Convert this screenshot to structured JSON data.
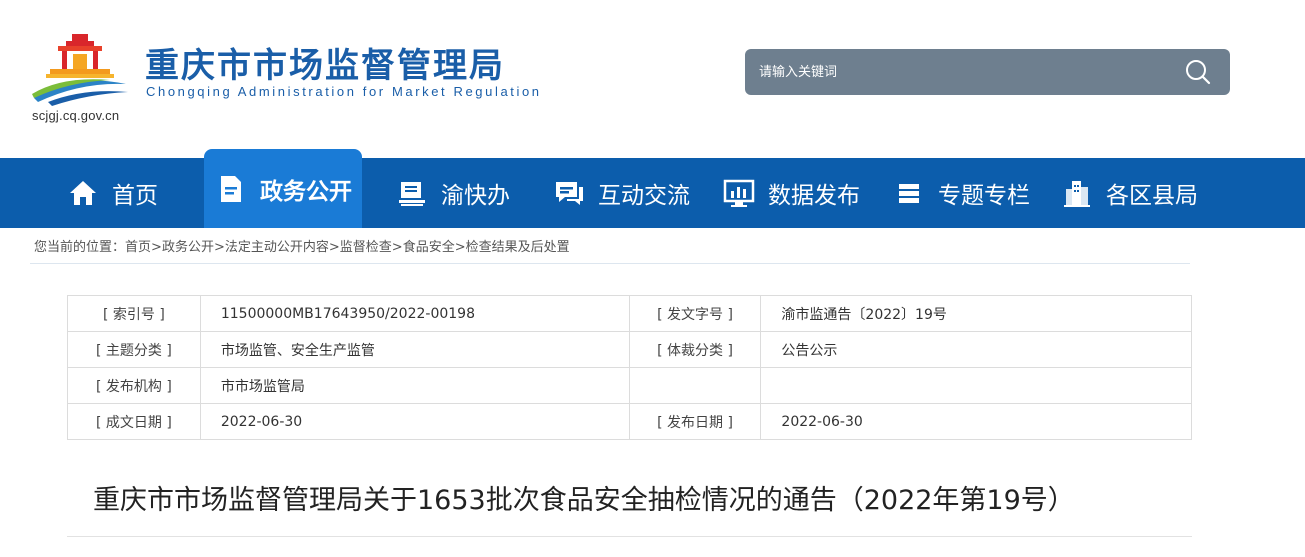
{
  "header": {
    "site_name": "重庆市市场监督管理局",
    "site_name_en": "Chongqing  Administration for Market Regulation",
    "site_url": "scjgj.cq.gov.cn",
    "logo_icon": "cq-amr-logo-icon"
  },
  "search": {
    "placeholder": "请输入关键词",
    "icon": "search-icon"
  },
  "nav": {
    "items": [
      {
        "label": "首页",
        "icon": "home-icon"
      },
      {
        "label": "政务公开",
        "icon": "document-icon",
        "active": true
      },
      {
        "label": "渝快办",
        "icon": "book-stack-icon"
      },
      {
        "label": "互动交流",
        "icon": "chat-icon"
      },
      {
        "label": "数据发布",
        "icon": "chart-monitor-icon"
      },
      {
        "label": "专题专栏",
        "icon": "layers-icon"
      },
      {
        "label": "各区县局",
        "icon": "buildings-icon"
      }
    ],
    "colors": {
      "bar": "#0c5dac",
      "active": "#1a7bd6"
    }
  },
  "breadcrumb": {
    "prefix": "您当前的位置：",
    "items": [
      "首页",
      "政务公开",
      "法定主动公开内容",
      "监督检查",
      "食品安全",
      "检查结果及后处置"
    ],
    "separator": ">"
  },
  "info_table": {
    "rows": [
      {
        "label1": "[ 索引号 ]",
        "value1": "11500000MB17643950/2022-00198",
        "label2": "[ 发文字号 ]",
        "value2": "渝市监通告〔2022〕19号"
      },
      {
        "label1": "[ 主题分类 ]",
        "value1": "市场监管、安全生产监管",
        "label2": "[ 体裁分类 ]",
        "value2": "公告公示"
      },
      {
        "label1": "[ 发布机构 ]",
        "value1": "市市场监管局",
        "label2": "",
        "value2": ""
      },
      {
        "label1": "[ 成文日期 ]",
        "value1": "2022-06-30",
        "label2": "[ 发布日期 ]",
        "value2": "2022-06-30"
      }
    ]
  },
  "article": {
    "title": "重庆市市场监督管理局关于1653批次食品安全抽检情况的通告（2022年第19号）"
  }
}
